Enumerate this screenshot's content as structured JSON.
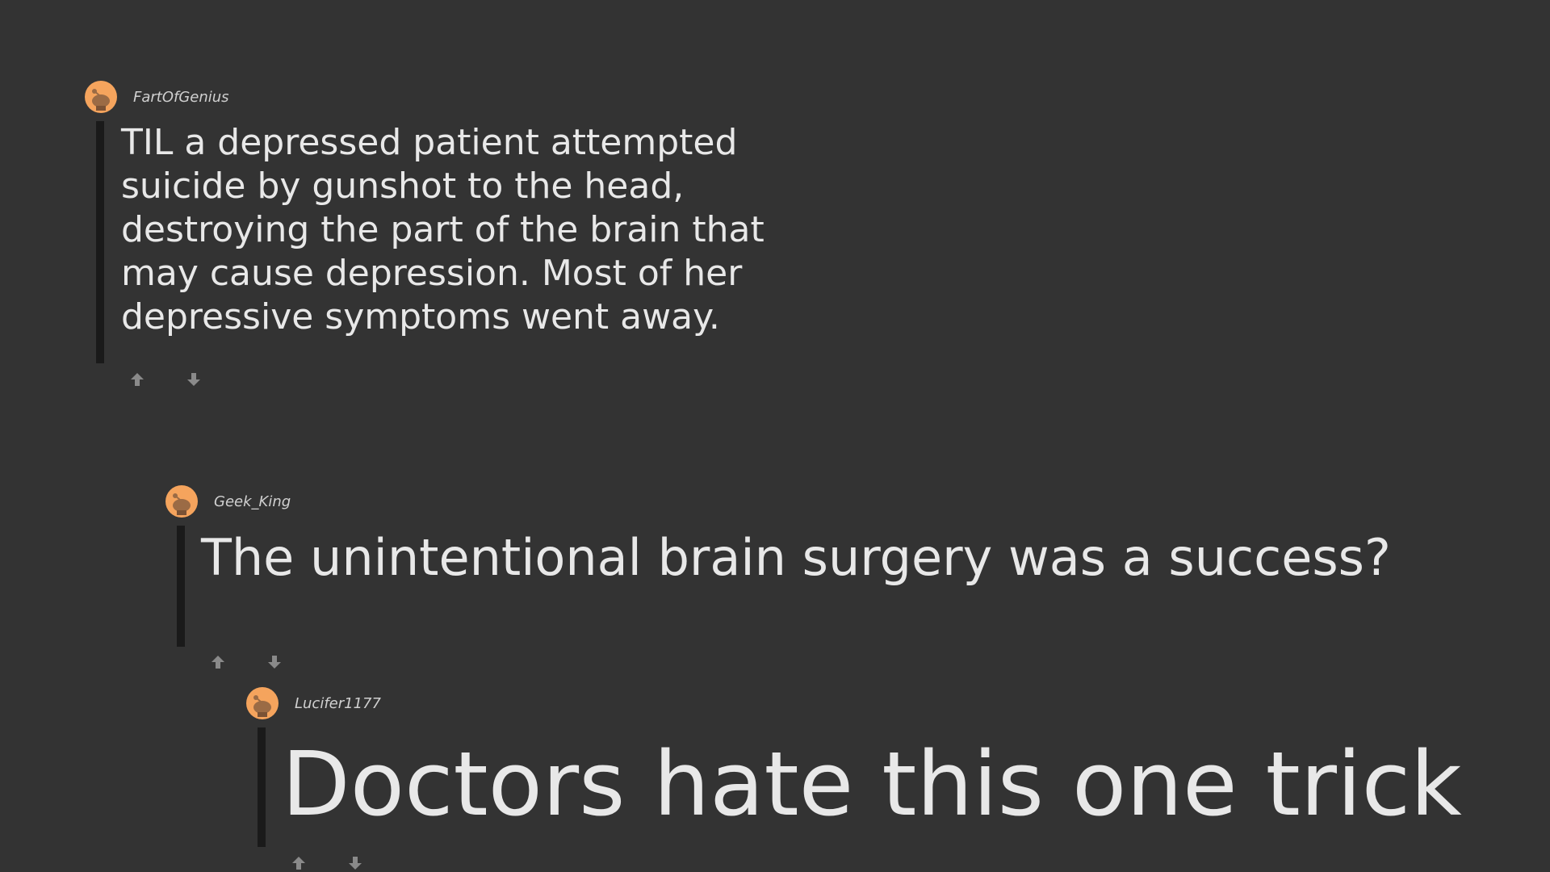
{
  "comments": [
    {
      "username": "FartOfGenius",
      "text": "TIL a depressed patient attempted suicide by gunshot to the head, destroying the part of the brain that may cause depression. Most of her depressive symptoms went away.",
      "avatar_icon": "reddit-snoo-avatar-icon",
      "upvote_icon": "upvote-arrow-icon",
      "downvote_icon": "downvote-arrow-icon"
    },
    {
      "username": "Geek_King",
      "text": "The unintentional brain surgery was a success?",
      "avatar_icon": "reddit-snoo-avatar-icon",
      "upvote_icon": "upvote-arrow-icon",
      "downvote_icon": "downvote-arrow-icon"
    },
    {
      "username": "Lucifer1177",
      "text": "Doctors hate this one trick",
      "avatar_icon": "reddit-snoo-avatar-icon",
      "upvote_icon": "upvote-arrow-icon",
      "downvote_icon": "downvote-arrow-icon"
    }
  ],
  "colors": {
    "background": "#333333",
    "text": "#e8e8e8",
    "username": "#d0d0d0",
    "thread_line": "#1a1a1a",
    "avatar": "#f5a45d",
    "vote_arrow": "#8a8a8a"
  }
}
